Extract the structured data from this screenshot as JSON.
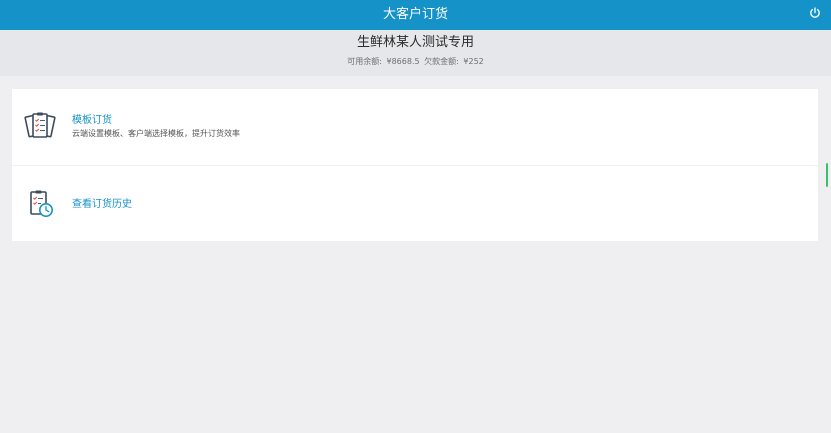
{
  "header": {
    "title": "大客户订货",
    "power_icon": "power-icon"
  },
  "account": {
    "name": "生鲜林某人测试专用",
    "available_label": "可用余额:",
    "available_value": "¥8668.5",
    "owed_label": "欠款金额:",
    "owed_value": "¥252"
  },
  "menu": {
    "template_order": {
      "title": "模板订货",
      "description": "云端设置模板、客户端选择模板，提升订货效率",
      "icon": "clipboard-documents-icon"
    },
    "order_history": {
      "title": "查看订货历史",
      "icon": "clipboard-clock-icon"
    }
  },
  "colors": {
    "header_bg": "#1592c8",
    "accent": "#1592c8",
    "scroll_indicator": "#38c26a"
  }
}
